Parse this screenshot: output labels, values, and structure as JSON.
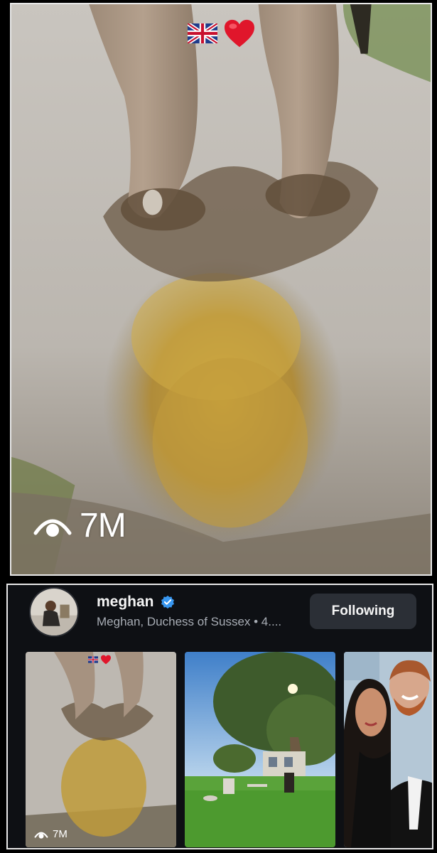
{
  "video": {
    "views": "7M",
    "overlay_emojis": [
      "uk-flag",
      "red-heart"
    ]
  },
  "profile": {
    "username": "meghan",
    "verified": true,
    "subtitle": "Meghan, Duchess of Sussex • 4....",
    "follow_label": "Following"
  },
  "grid": {
    "items": [
      {
        "kind": "video",
        "views": "7M",
        "subject": "bare-feet-stomping-mud-puddle"
      },
      {
        "kind": "photo",
        "subject": "garden-lawn-large-tree-chairs"
      },
      {
        "kind": "photo",
        "subject": "couple-selfie-formal-wear"
      }
    ]
  },
  "colors": {
    "card_bg": "#0e1014",
    "button_bg": "#2b2f36",
    "verified_blue": "#3897f0",
    "subtitle_gray": "#a8adb5"
  }
}
